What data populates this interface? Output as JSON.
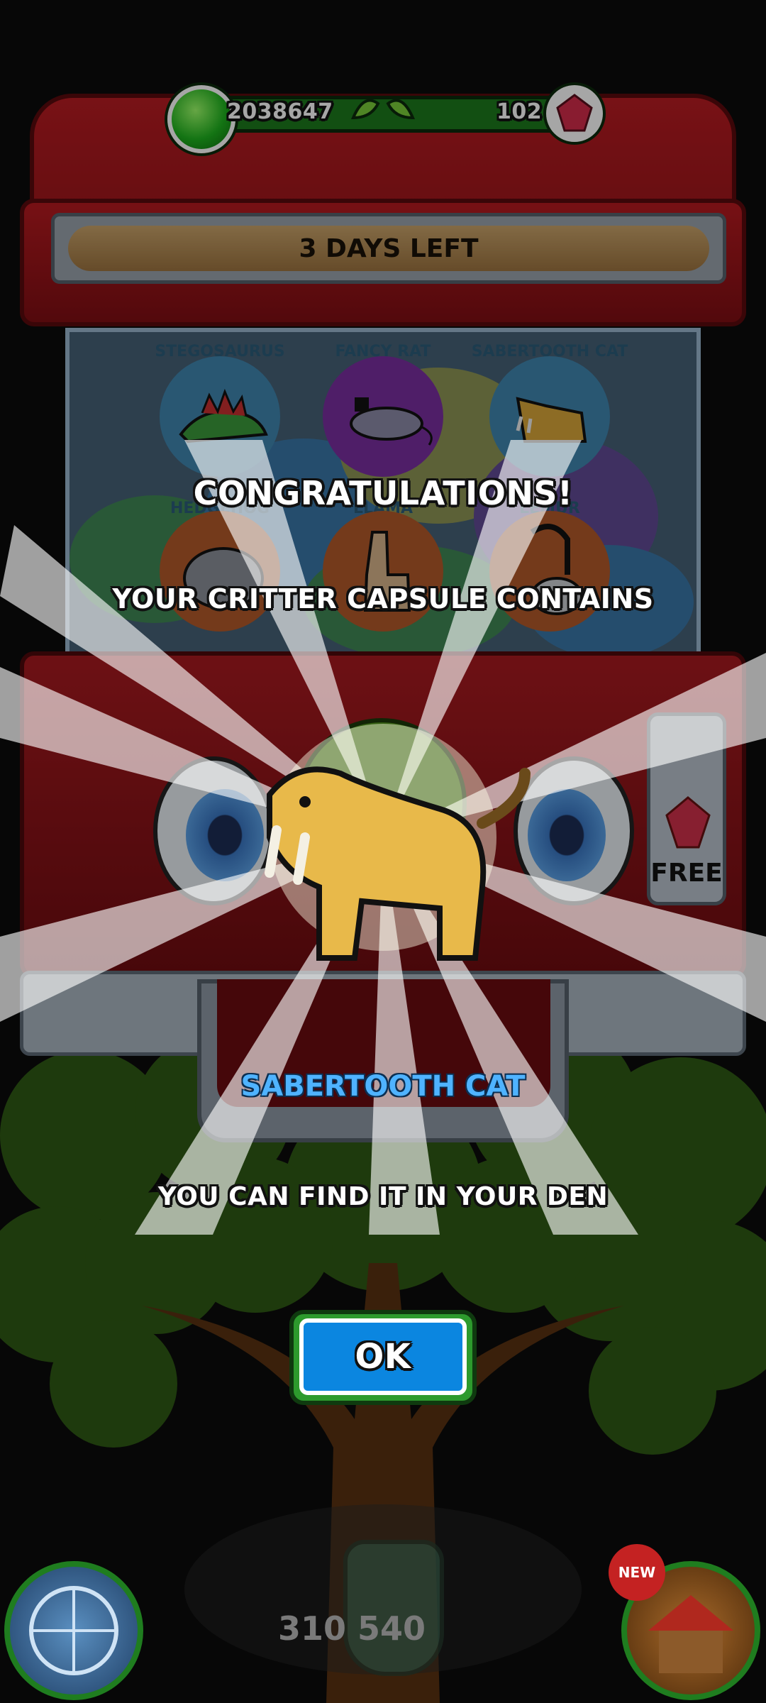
{
  "currency": {
    "coins": "2038647",
    "gems": "102"
  },
  "timer": {
    "label": "3 DAYS LEFT"
  },
  "critter_slots": [
    {
      "name": "STEGOSAURUS",
      "icon": "stegosaurus-icon",
      "color": "#3f86b0"
    },
    {
      "name": "FANCY RAT",
      "icon": "fancy-rat-icon",
      "color": "#7a2fa0"
    },
    {
      "name": "SABERTOOTH CAT",
      "icon": "sabertooth-cat-icon",
      "color": "#3f86b0"
    },
    {
      "name": "HEDGEHOG",
      "icon": "hedgehog-icon",
      "color": "#b35a2a"
    },
    {
      "name": "LLAMA",
      "icon": "llama-icon",
      "color": "#b35a2a"
    },
    {
      "name": "LEMUR",
      "icon": "lemur-icon",
      "color": "#b35a2a"
    }
  ],
  "popup": {
    "title": "CONGRATULATIONS!",
    "subtitle": "YOUR CRITTER CAPSULE CONTAINS",
    "critter_name": "SABERTOOTH CAT",
    "message": "YOU CAN FIND IT IN YOUR DEN",
    "ok_label": "OK"
  },
  "free_button": {
    "label": "FREE"
  },
  "bottom_hud": {
    "score": "310 540",
    "new_badge": "NEW"
  },
  "colors": {
    "machine_red": "#a81a20",
    "ok_blue": "#0b86e0",
    "frame_green": "#2d9a2d",
    "name_blue": "#4fb3ff"
  }
}
